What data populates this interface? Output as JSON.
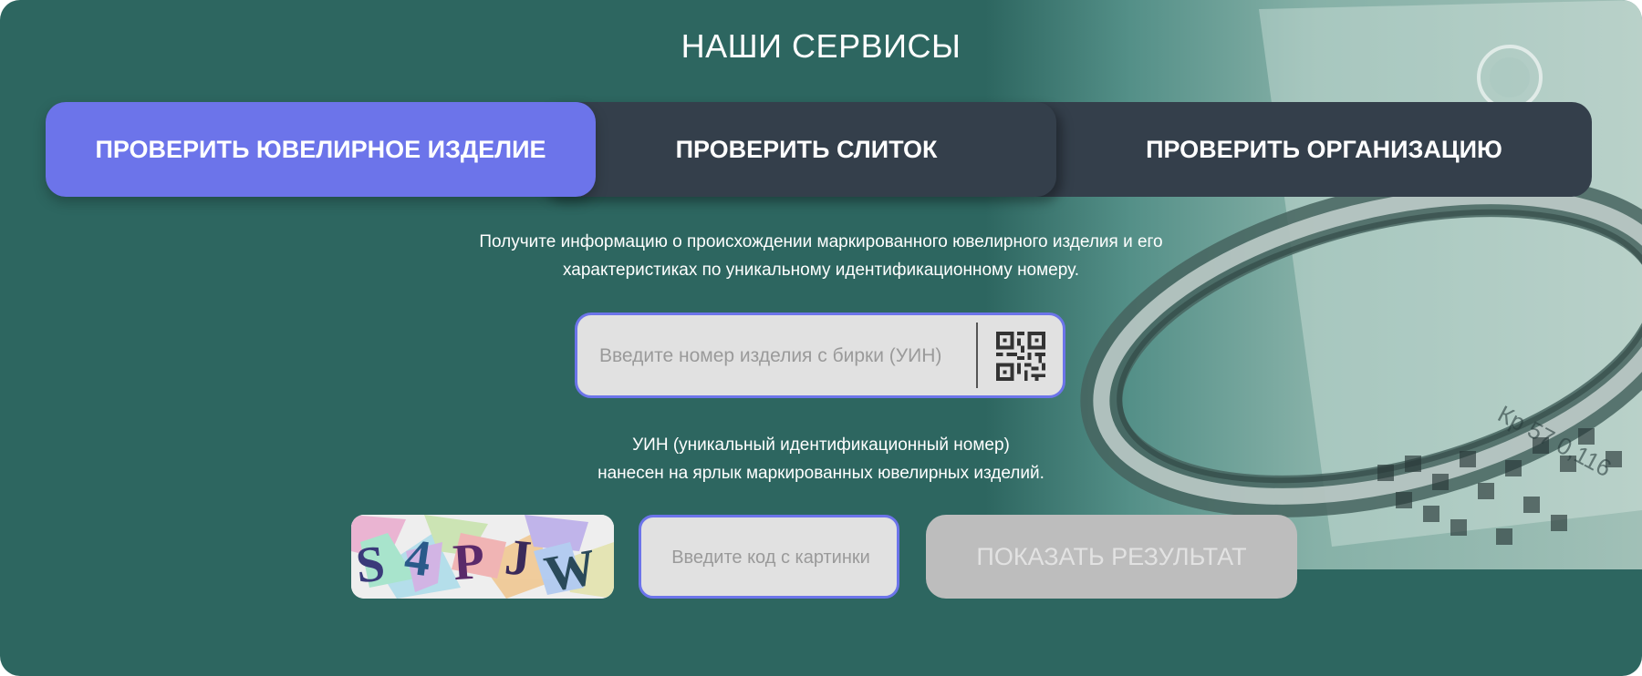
{
  "page": {
    "title": "НАШИ СЕРВИСЫ"
  },
  "tabs": [
    {
      "label": "ПРОВЕРИТЬ ЮВЕЛИРНОЕ ИЗДЕЛИЕ",
      "active": true
    },
    {
      "label": "ПРОВЕРИТЬ СЛИТОК",
      "active": false
    },
    {
      "label": "ПРОВЕРИТЬ ОРГАНИЗАЦИЮ",
      "active": false
    }
  ],
  "description": {
    "line1": "Получите информацию о происхождении маркированного ювелирного изделия и его",
    "line2": "характеристиках по уникальному идентификационному номеру."
  },
  "uin_field": {
    "placeholder": "Введите номер изделия с бирки (УИН)",
    "value": "",
    "scan_icon": "qr-code-icon"
  },
  "hint": {
    "line1": "УИН (уникальный идентификационный номер)",
    "line2": "нанесен на ярлык маркированных ювелирных изделий."
  },
  "captcha": {
    "text": "S4PJW",
    "code_placeholder": "Введите код с картинки",
    "code_value": ""
  },
  "submit": {
    "label": "ПОКАЗАТЬ РЕЗУЛЬТАТ",
    "enabled": false
  },
  "colors": {
    "panel_bg": "#2d6660",
    "tab_bar": "#343f4b",
    "accent": "#6c74ea",
    "input_bg": "#e1e1e1",
    "button_disabled": "#bdbdbd"
  },
  "background_image": {
    "engraving_text": "Кр 57 0,116"
  }
}
